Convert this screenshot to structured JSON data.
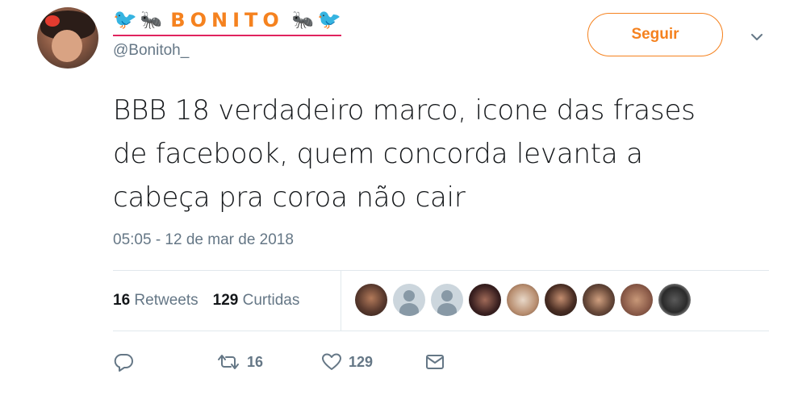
{
  "user": {
    "display_name": "BONITO",
    "handle": "@Bonitoh_"
  },
  "follow_button": {
    "label": "Seguir"
  },
  "tweet": {
    "text": "BBB 18 verdadeiro marco, icone das frases de facebook, quem concorda levanta a cabeça pra coroa não cair",
    "timestamp": "05:05 - 12 de mar de 2018"
  },
  "stats": {
    "retweets_count": "16",
    "retweets_label": "Retweets",
    "likes_count": "129",
    "likes_label": "Curtidas"
  },
  "actions": {
    "retweet_count": "16",
    "like_count": "129"
  },
  "icons": {
    "reply": "reply-icon",
    "retweet": "retweet-icon",
    "like": "heart-icon",
    "message": "envelope-icon",
    "caret": "chevron-down-icon"
  },
  "colors": {
    "accent": "#f5821f",
    "muted": "#657786",
    "text": "#14171a",
    "divider": "#e1e8ed"
  }
}
